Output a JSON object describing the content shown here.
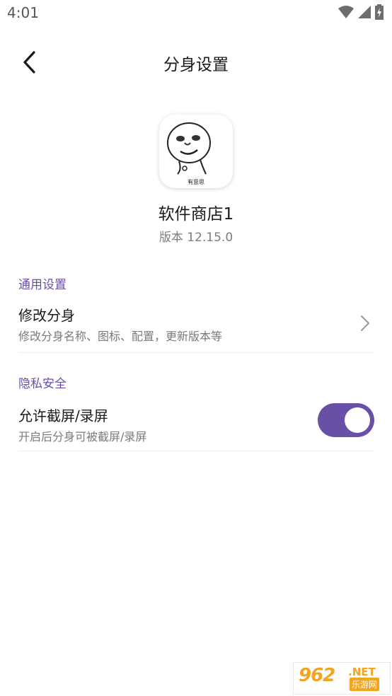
{
  "status_bar": {
    "time": "4:01"
  },
  "header": {
    "title": "分身设置"
  },
  "app": {
    "name": "软件商店1",
    "version": "版本 12.15.0",
    "icon_caption": "有意思"
  },
  "sections": {
    "general": {
      "label": "通用设置",
      "item": {
        "title": "修改分身",
        "subtitle": "修改分身名称、图标、配置，更新版本等"
      }
    },
    "privacy": {
      "label": "隐私安全",
      "item": {
        "title": "允许截屏/录屏",
        "subtitle": "开启后分身可被截屏/录屏",
        "toggle_on": true
      }
    }
  },
  "watermark": {
    "number": "962",
    "domain": ".NET",
    "cn": "乐游网"
  },
  "colors": {
    "accent": "#6850a6",
    "section_label": "#6a50a7",
    "watermark": "#f2a522"
  }
}
